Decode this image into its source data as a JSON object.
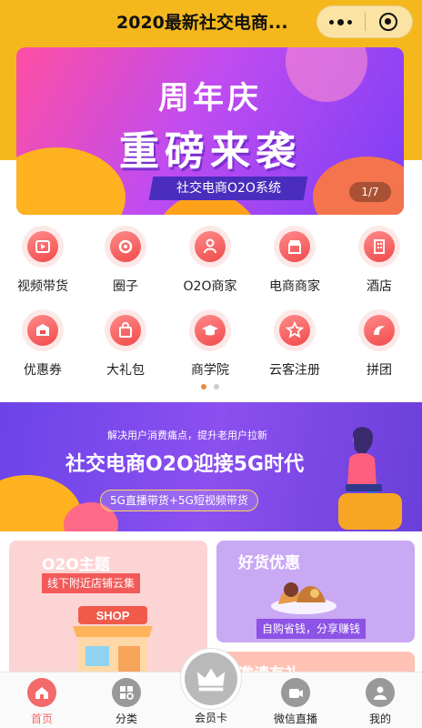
{
  "header": {
    "title": "2020最新社交电商...",
    "more_icon": "more-dots-icon",
    "close_icon": "target-close-icon"
  },
  "banner": {
    "line1": "周年庆",
    "line2": "重磅来袭",
    "ribbon": "社交电商O2O系统",
    "page_indicator": "1/7"
  },
  "grid": {
    "items": [
      {
        "label": "视频带货",
        "icon": "video-goods-icon"
      },
      {
        "label": "圈子",
        "icon": "circle-icon"
      },
      {
        "label": "O2O商家",
        "icon": "person-icon"
      },
      {
        "label": "电商商家",
        "icon": "shop-icon"
      },
      {
        "label": "酒店",
        "icon": "hotel-icon"
      },
      {
        "label": "优惠券",
        "icon": "coupon-icon"
      },
      {
        "label": "大礼包",
        "icon": "gift-bag-icon"
      },
      {
        "label": "商学院",
        "icon": "graduation-cap-icon"
      },
      {
        "label": "云客注册",
        "icon": "star-badge-icon"
      },
      {
        "label": "拼团",
        "icon": "group-buy-icon"
      }
    ]
  },
  "promo": {
    "subtitle": "解决用户消费痛点，提升老用户拉新",
    "title": "社交电商O2O迎接5G时代",
    "pill": "5G直播带货+5G短视频带货"
  },
  "cards": {
    "o2o": {
      "title": "O2O主题",
      "tag": "线下附近店铺云集",
      "shop_sign": "SHOP"
    },
    "goods": {
      "title": "好货优惠",
      "tag": "自购省钱，分享赚钱"
    },
    "invite": {
      "title": "邀请有礼"
    }
  },
  "tabbar": {
    "items": [
      {
        "label": "首页",
        "icon": "home-icon",
        "active": true
      },
      {
        "label": "分类",
        "icon": "category-icon"
      },
      {
        "label": "会员卡",
        "icon": "crown-icon"
      },
      {
        "label": "微信直播",
        "icon": "live-icon"
      },
      {
        "label": "我的",
        "icon": "user-icon"
      }
    ]
  },
  "colors": {
    "header_bg": "#f5b81c",
    "accent": "#f26a6a",
    "icon_red": "#f14b4b"
  }
}
